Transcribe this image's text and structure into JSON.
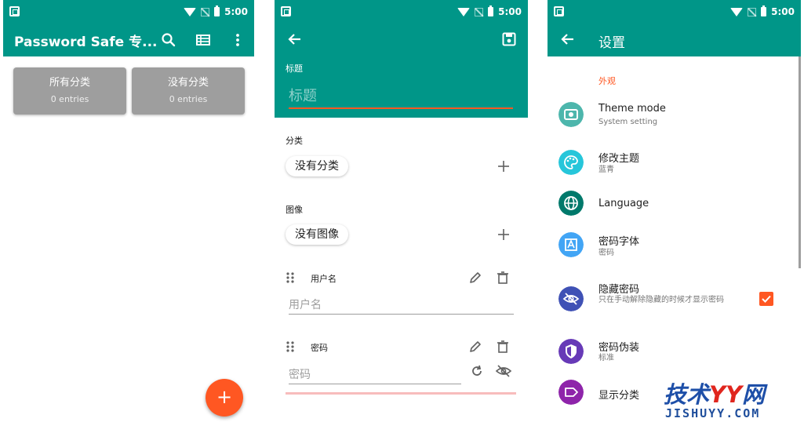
{
  "colors": {
    "primary": "#009688",
    "accent": "#ff5722",
    "card": "#9e9e9e",
    "icon_teal_light": "#4db6ac",
    "icon_cyan": "#26c6da",
    "icon_teal_dark": "#00796b",
    "icon_blue": "#42a5f5",
    "icon_indigo": "#3f51b5",
    "icon_purple": "#673ab7",
    "icon_violet": "#8e24aa"
  },
  "status_bar": {
    "time": "5:00"
  },
  "screen1": {
    "app_title": "Password Safe 专...",
    "toolbar_icons": [
      "search-icon",
      "view-list-icon",
      "more-vert-icon"
    ],
    "categories": [
      {
        "name": "所有分类",
        "count": "0 entries"
      },
      {
        "name": "没有分类",
        "count": "0 entries"
      }
    ],
    "fab_label": "+"
  },
  "screen2": {
    "title_label": "标题",
    "title_placeholder": "标题",
    "category_label": "分类",
    "category_value": "没有分类",
    "image_label": "图像",
    "image_value": "没有图像",
    "fields": [
      {
        "label": "用户名",
        "placeholder": "用户名"
      },
      {
        "label": "密码",
        "placeholder": "密码"
      }
    ]
  },
  "screen3": {
    "title": "设置",
    "section_appearance": "外观",
    "items": [
      {
        "title": "Theme mode",
        "subtitle": "System setting",
        "icon": "theme-mode-icon"
      },
      {
        "title": "修改主题",
        "subtitle": "蓝青",
        "icon": "palette-icon"
      },
      {
        "title": "Language",
        "subtitle": "",
        "icon": "globe-icon"
      },
      {
        "title": "密码字体",
        "subtitle": "密码",
        "icon": "font-icon"
      },
      {
        "title": "隐藏密码",
        "subtitle": "只在手动解除隐藏的时候才显示密码",
        "icon": "eye-off-icon",
        "checked": true
      },
      {
        "title": "密码伪装",
        "subtitle": "标准",
        "icon": "shield-icon"
      },
      {
        "title": "显示分类",
        "subtitle": "",
        "icon": "label-icon"
      }
    ]
  },
  "watermark": {
    "brand_cn_1": "技术",
    "brand_yy": "YY",
    "brand_cn_2": "网",
    "domain": "JISHUYY.COM"
  }
}
